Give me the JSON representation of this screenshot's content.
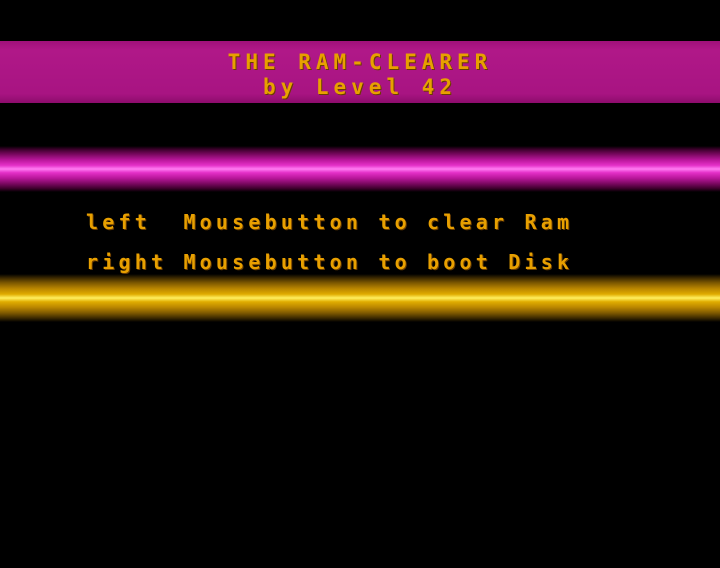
{
  "title": {
    "line1": "THE RAM-CLEARER",
    "line2": "by Level 42"
  },
  "instructions": [
    {
      "text": "left  Mousebutton to clear Ram"
    },
    {
      "text": "right Mousebutton to boot Disk"
    }
  ],
  "colors": {
    "background": "#000000",
    "text": "#e8a000",
    "title_band": "#a0107a",
    "magenta_bar": "#e430c8",
    "gold_bar": "#e0ac00"
  }
}
